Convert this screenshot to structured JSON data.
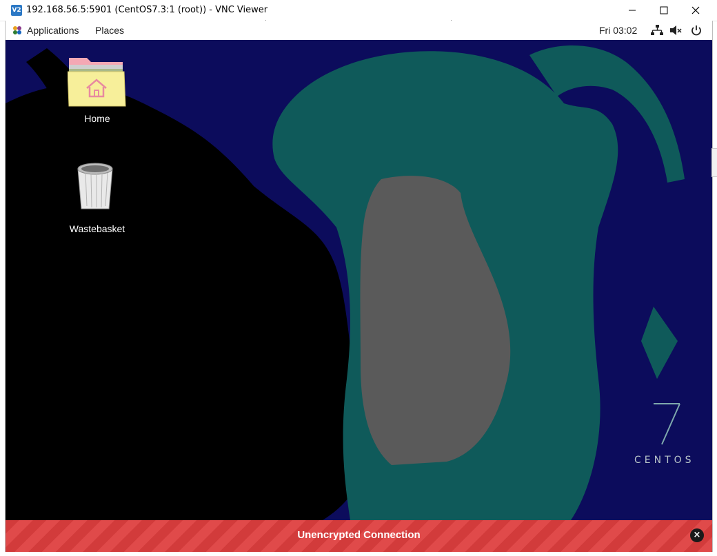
{
  "window": {
    "app_icon_text": "V2",
    "title": "192.168.56.5:5901 (CentOS7.3:1 (root)) - VNC Viewer",
    "minimize_icon": "minimize-icon",
    "maximize_icon": "maximize-icon",
    "close_icon": "close-icon"
  },
  "gnome_panel": {
    "menus": [
      {
        "label": "Applications",
        "icon": "applications-icon"
      },
      {
        "label": "Places"
      }
    ],
    "clock": "Fri 03:02",
    "tray_icons": [
      "network-icon",
      "volume-muted-icon",
      "power-icon"
    ]
  },
  "desktop": {
    "icons": [
      {
        "label": "Home",
        "icon": "home-folder-icon"
      },
      {
        "label": "Wastebasket",
        "icon": "trash-icon"
      }
    ],
    "wallpaper_brand": {
      "number": "7",
      "text": "CENTOS"
    }
  },
  "banner": {
    "text": "Unencrypted Connection",
    "close_icon": "close-circle-icon"
  },
  "colors": {
    "banner_red": "#d23b3b",
    "wallpaper_navy": "#0c0c5c",
    "wallpaper_teal": "#0f5a5a",
    "wallpaper_gray": "#5a5a5a"
  }
}
